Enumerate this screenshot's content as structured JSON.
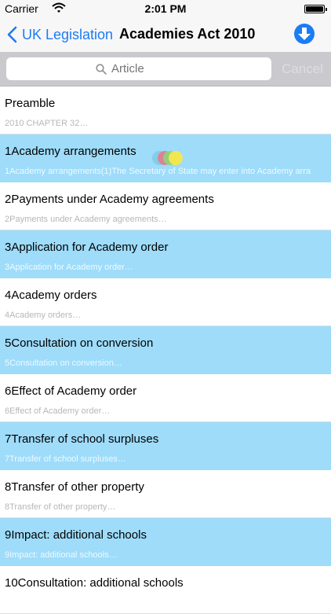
{
  "status_bar": {
    "carrier": "Carrier",
    "time": "2:01 PM"
  },
  "nav": {
    "back_label": "UK Legislation",
    "title": "Academies Act 2010"
  },
  "search": {
    "placeholder": "Article",
    "cancel_label": "Cancel"
  },
  "rows": [
    {
      "title": "Preamble",
      "subtitle": "2010 CHAPTER 32…"
    },
    {
      "title": "1Academy arrangements",
      "subtitle": "1Academy arrangements(1)The Secretary of State may enter into Academy arra"
    },
    {
      "title": "2Payments under Academy agreements",
      "subtitle": "2Payments under Academy agreements…"
    },
    {
      "title": "3Application for Academy order",
      "subtitle": "3Application for Academy order…"
    },
    {
      "title": "4Academy orders",
      "subtitle": "4Academy orders…"
    },
    {
      "title": "5Consultation on conversion",
      "subtitle": "5Consultation on conversion…"
    },
    {
      "title": "6Effect of Academy order",
      "subtitle": "6Effect of Academy order…"
    },
    {
      "title": "7Transfer of school surpluses",
      "subtitle": "7Transfer of school surpluses…"
    },
    {
      "title": "8Transfer of other property",
      "subtitle": "8Transfer of other property…"
    },
    {
      "title": "9Impact: additional schools",
      "subtitle": "9Impact: additional schools…"
    },
    {
      "title": "10Consultation: additional schools",
      "subtitle": ""
    }
  ],
  "colors": {
    "accent": "#1c7cf4",
    "row_highlight": "#9edcfa"
  }
}
